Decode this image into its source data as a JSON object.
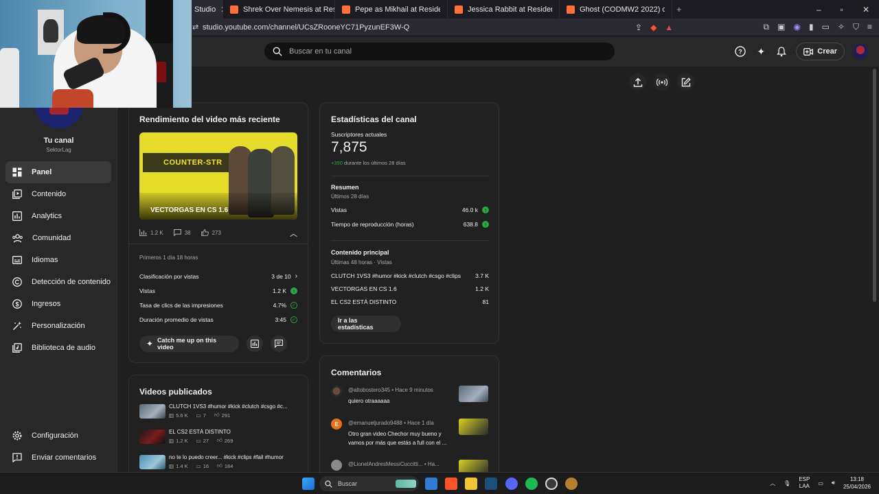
{
  "browser": {
    "tabs": [
      {
        "title": "Studio",
        "active": true
      },
      {
        "title": "Shrek Over Nemesis at Resident Evil",
        "active": false
      },
      {
        "title": "Pepe as Mikhail at Resident Evil 3 (20",
        "active": false
      },
      {
        "title": "Jessica Rabbit at Resident Evil 3 (202",
        "active": false
      },
      {
        "title": "Ghost (CODMW2 2022) over Carlos",
        "active": false
      }
    ],
    "url": "studio.youtube.com/channel/UCsZRooneYC71PyzunEF3W-Q"
  },
  "header": {
    "search_placeholder": "Buscar en tu canal",
    "create_label": "Crear"
  },
  "sidebar": {
    "channel_name": "Tu canal",
    "channel_handle": "SektorLag",
    "items": [
      {
        "label": "Panel",
        "icon": "dashboard-icon",
        "active": true
      },
      {
        "label": "Contenido",
        "icon": "content-icon"
      },
      {
        "label": "Analytics",
        "icon": "analytics-icon"
      },
      {
        "label": "Comunidad",
        "icon": "community-icon"
      },
      {
        "label": "Idiomas",
        "icon": "subtitles-icon"
      },
      {
        "label": "Detección de contenido",
        "icon": "copyright-icon"
      },
      {
        "label": "Ingresos",
        "icon": "dollar-icon"
      },
      {
        "label": "Personalización",
        "icon": "magic-wand-icon"
      },
      {
        "label": "Biblioteca de audio",
        "icon": "audio-library-icon"
      }
    ],
    "bottom_items": [
      {
        "label": "Configuración",
        "icon": "gear-icon"
      },
      {
        "label": "Enviar comentarios",
        "icon": "feedback-icon"
      }
    ]
  },
  "page": {
    "title_visible": "nal"
  },
  "latest_video": {
    "heading": "Rendimiento del video más reciente",
    "thumb_logo": "COUNTER-STR",
    "thumb_caption": "VECTORGAS EN CS 1.6",
    "views": "1.2 K",
    "comments": "38",
    "likes": "273",
    "period": "Primeros 1 día 18 horas",
    "metrics": [
      {
        "label": "Clasificación por vistas",
        "value": "3 de 10"
      },
      {
        "label": "Vistas",
        "value": "1.2 K"
      },
      {
        "label": "Tasa de clics de las impresiones",
        "value": "4.7%"
      },
      {
        "label": "Duración promedio de vistas",
        "value": "3:45"
      }
    ],
    "catch_up_label": "Catch me up on this video"
  },
  "channel_stats": {
    "heading": "Estadísticas del canal",
    "subs_label": "Suscriptores actuales",
    "subs_value": "7,875",
    "subs_delta": "+390",
    "subs_delta_text": "durante los últimos 28 días",
    "summary_label": "Resumen",
    "summary_period": "Últimos 28 días",
    "summary": [
      {
        "label": "Vistas",
        "value": "46.0 k"
      },
      {
        "label": "Tiempo de reproducción (horas)",
        "value": "638.8"
      }
    ],
    "top_label": "Contenido principal",
    "top_period": "Últimas 48 horas · Vistas",
    "top": [
      {
        "title": "CLUTCH 1VS3 #humor #kick #clutch #csgo #clips",
        "value": "3.7 K"
      },
      {
        "title": "VECTORGAS EN CS 1.6",
        "value": "1.2 K"
      },
      {
        "title": "EL CS2 ESTÁ DISTINTO",
        "value": "81"
      }
    ],
    "go_label": "Ir a las estadísticas"
  },
  "published": {
    "heading": "Videos publicados",
    "videos": [
      {
        "title": "CLUTCH 1VS3 #humor #kick #clutch #csgo #c...",
        "views": "5.6 K",
        "comments": "7",
        "likes": "291"
      },
      {
        "title": "EL CS2 ESTÁ DISTINTO",
        "views": "1.2 K",
        "comments": "27",
        "likes": "269"
      },
      {
        "title": "no te lo puedo creer... #kick #clips #fail #humor",
        "views": "1.4 K",
        "comments": "16",
        "likes": "184"
      }
    ]
  },
  "comments": {
    "heading": "Comentarios",
    "items": [
      {
        "author": "@altobostero345",
        "time": "• Hace 9 minutos",
        "text": "quiero otraaaaaa"
      },
      {
        "author": "@emanueljurado9488",
        "time": "• Hace 1 día",
        "text": "Otro gran video Chechor muy bueno y vamos por más que estás a full con el ...",
        "initial": "E"
      },
      {
        "author": "@LionelAndresMessiCuccitti...",
        "time": "• Ha...",
        "text": ""
      }
    ]
  },
  "taskbar": {
    "search_label": "Buscar",
    "lang1": "ESP",
    "lang2": "LAA",
    "time": "13:18",
    "date": "25/04/2026"
  },
  "colors": {
    "accent_green": "#2ba640",
    "background": "#1f1f1f",
    "card": "#212121"
  }
}
